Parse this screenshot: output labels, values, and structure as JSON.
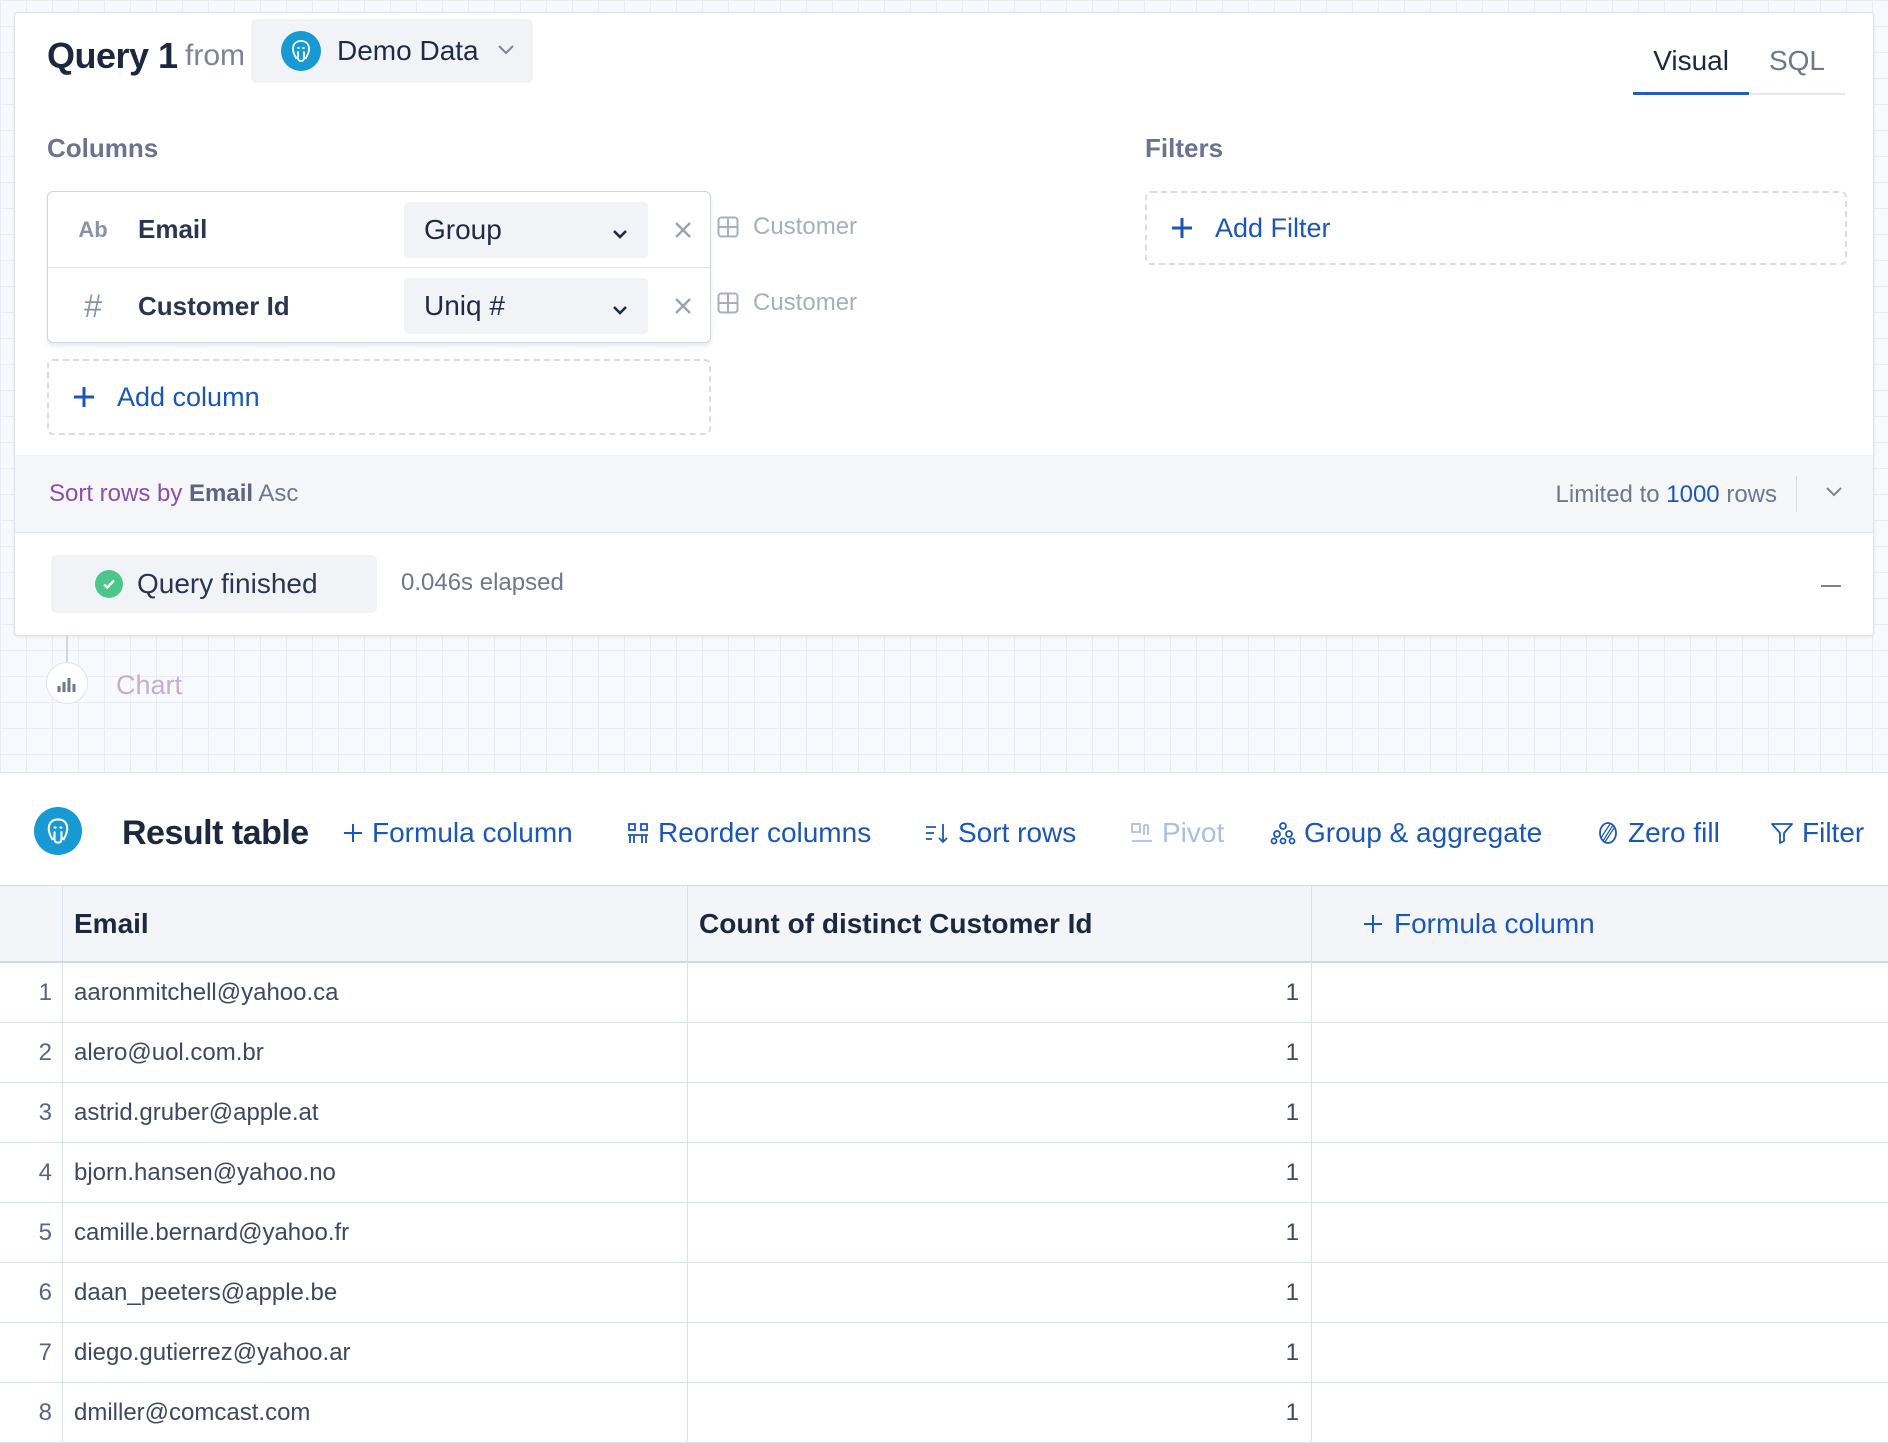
{
  "query": {
    "title": "Query 1",
    "from_label": "from",
    "datasource": "Demo Data",
    "tabs": [
      {
        "label": "Visual",
        "active": true
      },
      {
        "label": "SQL",
        "active": false
      }
    ],
    "columns_label": "Columns",
    "filters_label": "Filters",
    "columns": [
      {
        "type_icon": "Ab",
        "name": "Email",
        "aggregation": "Group",
        "table": "Customer"
      },
      {
        "type_icon": "#",
        "name": "Customer Id",
        "aggregation": "Uniq #",
        "table": "Customer"
      }
    ],
    "add_column_label": "Add column",
    "add_filter_label": "Add Filter",
    "sort": {
      "prefix": "Sort rows by",
      "field": "Email",
      "direction": "Asc"
    },
    "limit": {
      "prefix": "Limited to",
      "value": "1000",
      "suffix": "rows"
    },
    "status": {
      "label": "Query finished",
      "elapsed": "0.046s elapsed"
    }
  },
  "chart_step": {
    "label": "Chart"
  },
  "result": {
    "title": "Result table",
    "toolbar": [
      {
        "label": "Formula column",
        "icon": "plus-icon",
        "enabled": true
      },
      {
        "label": "Reorder columns",
        "icon": "reorder-icon",
        "enabled": true
      },
      {
        "label": "Sort rows",
        "icon": "sort-icon",
        "enabled": true
      },
      {
        "label": "Pivot",
        "icon": "pivot-icon",
        "enabled": false
      },
      {
        "label": "Group & aggregate",
        "icon": "group-icon",
        "enabled": true
      },
      {
        "label": "Zero fill",
        "icon": "zero-fill-icon",
        "enabled": true
      },
      {
        "label": "Filter",
        "icon": "filter-icon",
        "enabled": true
      }
    ],
    "headers": {
      "email": "Email",
      "count": "Count of distinct Customer Id",
      "formula": "Formula column"
    },
    "rows": [
      {
        "index": "1",
        "email": "aaronmitchell@yahoo.ca",
        "count": "1"
      },
      {
        "index": "2",
        "email": "alero@uol.com.br",
        "count": "1"
      },
      {
        "index": "3",
        "email": "astrid.gruber@apple.at",
        "count": "1"
      },
      {
        "index": "4",
        "email": "bjorn.hansen@yahoo.no",
        "count": "1"
      },
      {
        "index": "5",
        "email": "camille.bernard@yahoo.fr",
        "count": "1"
      },
      {
        "index": "6",
        "email": "daan_peeters@apple.be",
        "count": "1"
      },
      {
        "index": "7",
        "email": "diego.gutierrez@yahoo.ar",
        "count": "1"
      },
      {
        "index": "8",
        "email": "dmiller@comcast.com",
        "count": "1"
      }
    ]
  },
  "colors": {
    "accent": "#1a57b8",
    "success": "#4bc78b",
    "postgres": "#1799d3",
    "sort_text": "#8e4ea8"
  }
}
